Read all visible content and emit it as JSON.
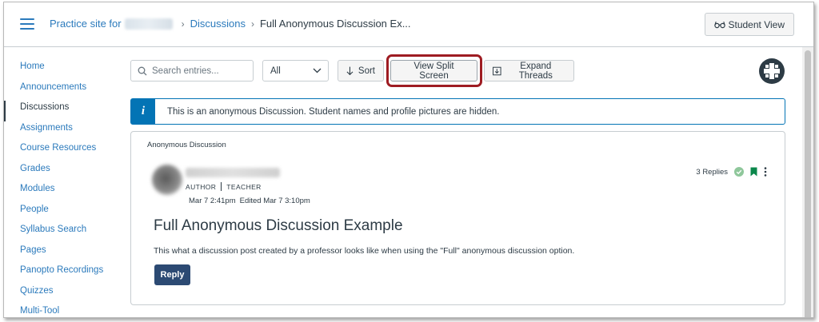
{
  "header": {
    "breadcrumbs": [
      {
        "label": "Practice site for"
      },
      {
        "label": "Discussions"
      },
      {
        "label": "Full Anonymous Discussion Ex..."
      }
    ],
    "student_view_label": "Student View"
  },
  "sidebar": {
    "items": [
      {
        "label": "Home"
      },
      {
        "label": "Announcements"
      },
      {
        "label": "Discussions",
        "active": true
      },
      {
        "label": "Assignments"
      },
      {
        "label": "Course Resources"
      },
      {
        "label": "Grades"
      },
      {
        "label": "Modules"
      },
      {
        "label": "People"
      },
      {
        "label": "Syllabus Search"
      },
      {
        "label": "Pages"
      },
      {
        "label": "Panopto Recordings"
      },
      {
        "label": "Quizzes"
      },
      {
        "label": "Multi-Tool"
      }
    ]
  },
  "toolbar": {
    "search_placeholder": "Search entries...",
    "filter_selected": "All",
    "sort_label": "Sort",
    "split_screen_label": "View Split Screen",
    "expand_label": "Expand Threads"
  },
  "banner": {
    "text": "This is an anonymous Discussion. Student names and profile pictures are hidden."
  },
  "post": {
    "card_label": "Anonymous Discussion",
    "role_author": "AUTHOR",
    "role_teacher": "TEACHER",
    "posted": "Mar 7 2:41pm",
    "edited": "Edited Mar 7 3:10pm",
    "replies": "3 Replies",
    "title": "Full Anonymous Discussion Example",
    "body": "This what a discussion post created by a professor looks like when using the \"Full\" anonymous discussion option.",
    "reply_label": "Reply"
  },
  "colors": {
    "link": "#2b7abc",
    "info": "#0374b5",
    "highlight": "#9e1c22",
    "reply_button": "#2c4a73",
    "bookmark": "#0b874b"
  }
}
